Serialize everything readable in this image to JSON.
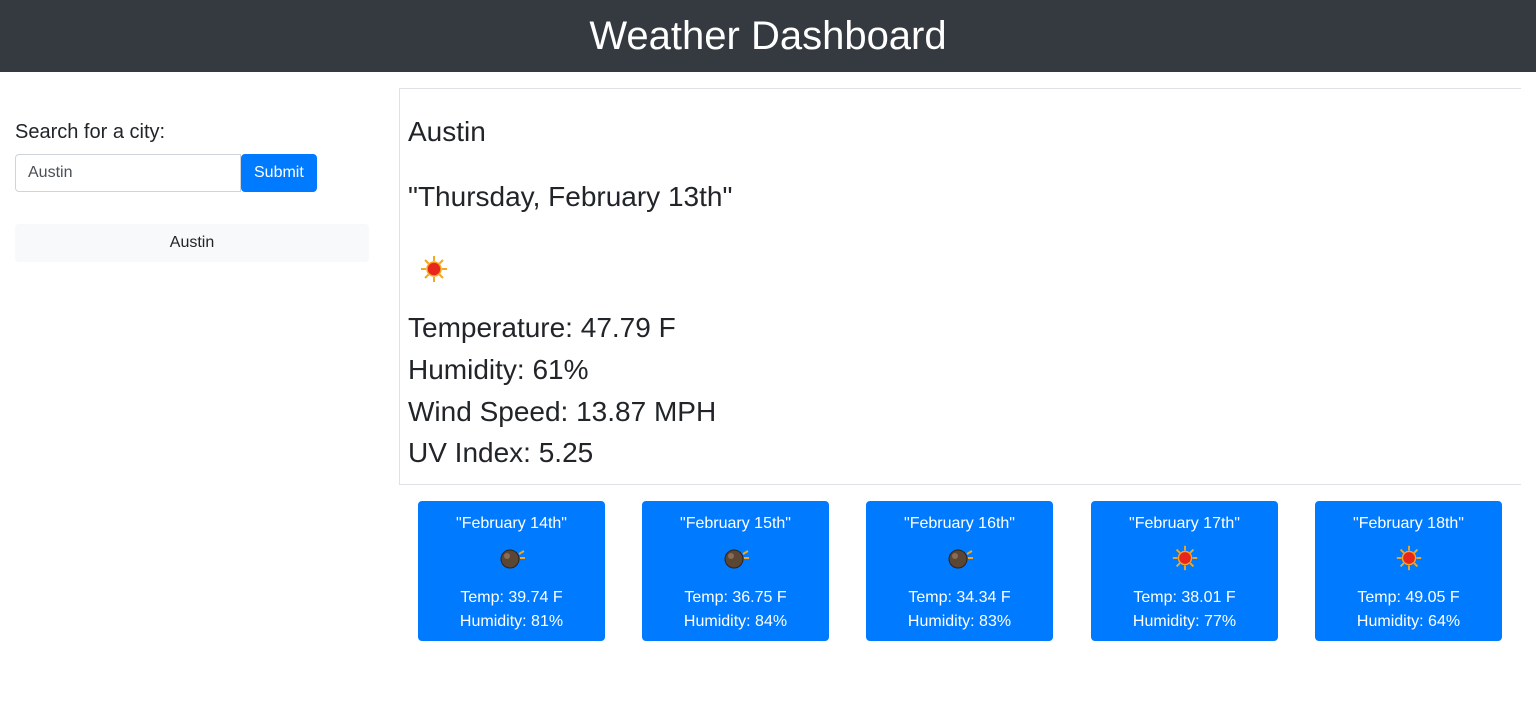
{
  "header": {
    "title": "Weather Dashboard"
  },
  "search": {
    "label": "Search for a city:",
    "value": "Austin",
    "submit_label": "Submit"
  },
  "history": {
    "items": [
      "Austin"
    ]
  },
  "current": {
    "city": "Austin",
    "date": "\"Thursday, February 13th\"",
    "icon": "sun-icon",
    "temperature": "Temperature: 47.79 F",
    "humidity": "Humidity: 61%",
    "wind": "Wind Speed: 13.87 MPH",
    "uv": "UV Index: 5.25"
  },
  "forecast": [
    {
      "date": "\"February 14th\"",
      "icon": "cloud-icon",
      "temp": "Temp: 39.74 F",
      "humidity": "Humidity: 81%"
    },
    {
      "date": "\"February 15th\"",
      "icon": "cloud-icon",
      "temp": "Temp: 36.75 F",
      "humidity": "Humidity: 84%"
    },
    {
      "date": "\"February 16th\"",
      "icon": "cloud-icon",
      "temp": "Temp: 34.34 F",
      "humidity": "Humidity: 83%"
    },
    {
      "date": "\"February 17th\"",
      "icon": "sun-icon",
      "temp": "Temp: 38.01 F",
      "humidity": "Humidity: 77%"
    },
    {
      "date": "\"February 18th\"",
      "icon": "sun-icon",
      "temp": "Temp: 49.05 F",
      "humidity": "Humidity: 64%"
    }
  ],
  "colors": {
    "header_bg": "#343a40",
    "accent": "#007bff",
    "history_bg": "#f8f9fa"
  }
}
